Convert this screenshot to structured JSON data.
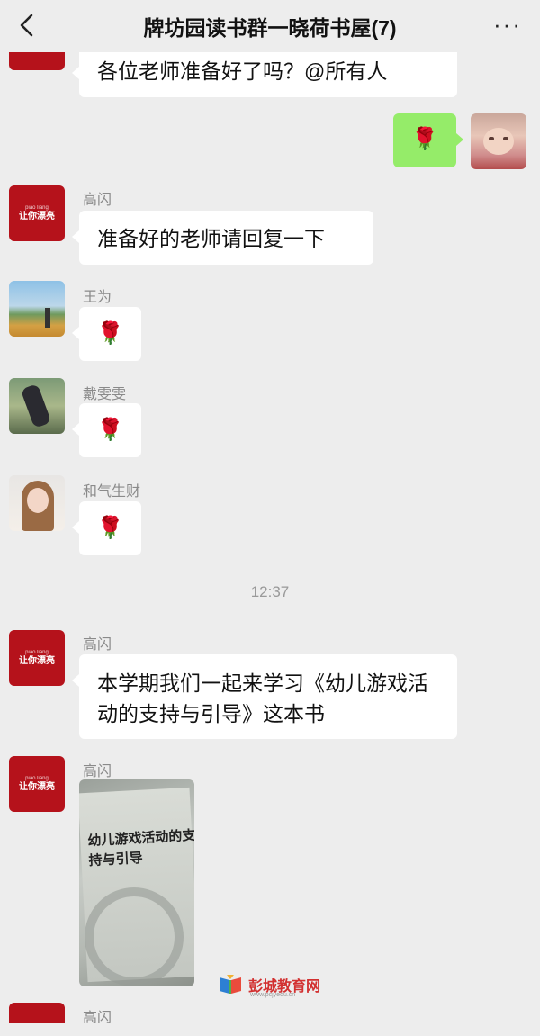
{
  "header": {
    "title": "牌坊园读书群一晓荷书屋(7)",
    "more_label": "···"
  },
  "messages": [
    {
      "text": "各位老师准备好了吗？@所有人"
    },
    {
      "rose": "🌹"
    },
    {
      "sender": "高闪",
      "text": "准备好的老师请回复一下"
    },
    {
      "sender": "王为",
      "rose": "🌹"
    },
    {
      "sender": "戴雯雯",
      "rose": "🌹"
    },
    {
      "sender": "和气生财",
      "rose": "🌹"
    },
    {
      "sender": "高闪",
      "text": "本学期我们一起来学习《幼儿游戏活动的支持与引导》这本书"
    },
    {
      "sender": "高闪",
      "image_title": "幼儿游戏活动的支持与引导"
    },
    {
      "sender": "高闪"
    }
  ],
  "timestamp": "12:37",
  "avatar_text": {
    "small": "piao liang",
    "big": "让你漂亮"
  },
  "watermark": {
    "text": "彭城教育网",
    "url": "www.pcjyedu.cn"
  },
  "colors": {
    "brand_red": "#b5121b",
    "bubble_green": "#95ec69",
    "background": "#ededed"
  }
}
